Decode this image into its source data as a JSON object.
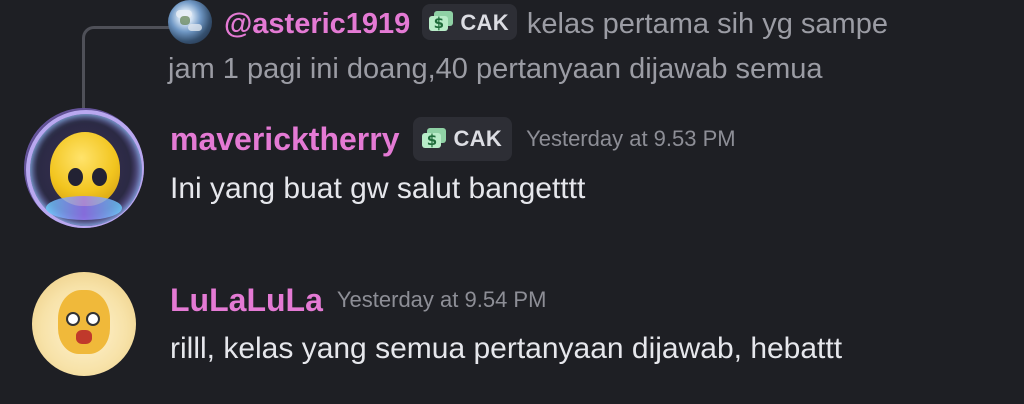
{
  "reply": {
    "mention": "@asteric1919",
    "tag_label": "CAK",
    "text_line1": "kelas pertama sih yg sampe",
    "text_line2": "jam 1 pagi ini doang,40 pertanyaan dijawab semua"
  },
  "messages": [
    {
      "username": "mavericktherry",
      "tag_label": "CAK",
      "timestamp": "Yesterday at 9.53 PM",
      "text": "Ini yang buat gw salut bangetttt"
    },
    {
      "username": "LuLaLuLa",
      "timestamp": "Yesterday at 9.54 PM",
      "text": "rilll, kelas yang semua pertanyaan dijawab, hebattt"
    }
  ],
  "colors": {
    "background": "#1e1f24",
    "username": "#e47ad4",
    "text": "#e6e7ec",
    "muted": "#8d8e96",
    "tag_bg": "#2d2e35"
  },
  "icons": {
    "tag": "dollar-bill-icon",
    "reply_avatar": "earth-avatar"
  }
}
